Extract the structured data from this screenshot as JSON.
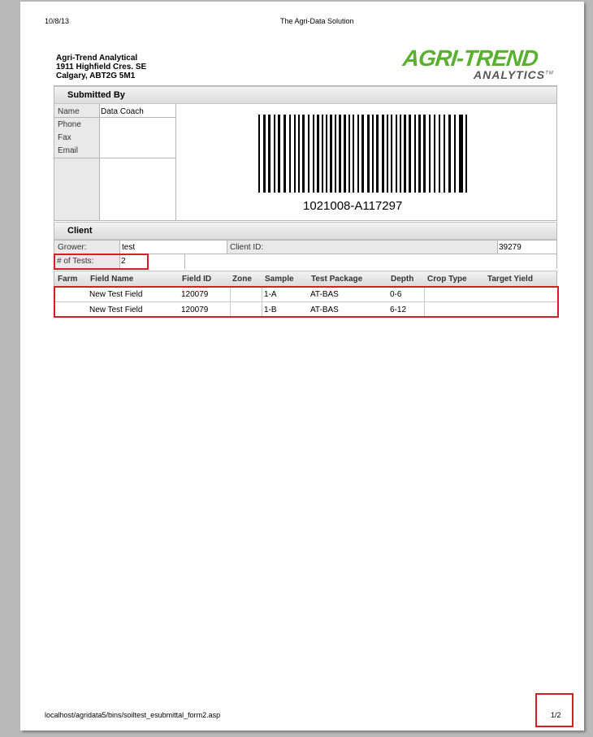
{
  "header": {
    "date": "10/8/13",
    "title": "The Agri-Data Solution"
  },
  "lab": {
    "name": "Agri-Trend Analytical",
    "street": "1911 Highfield Cres. SE",
    "city": "Calgary, ABT2G 5M1"
  },
  "logo": {
    "top": "AGRI-TREND",
    "bottom": "ANALYTICS",
    "tm": "TM"
  },
  "submitted_by": {
    "heading": "Submitted By",
    "name_label": "Name",
    "name_value": "Data Coach",
    "phone_label": "Phone",
    "fax_label": "Fax",
    "email_label": "Email"
  },
  "barcode": {
    "text": "1021008-A117297"
  },
  "client": {
    "heading": "Client",
    "grower_label": "Grower:",
    "grower_value": "test",
    "client_id_label": "Client ID:",
    "client_id_value": "39279",
    "tests_label": "# of Tests:",
    "tests_value": "2"
  },
  "table": {
    "headers": [
      "Farm",
      "Field Name",
      "Field ID",
      "Zone",
      "Sample",
      "Test Package",
      "Depth",
      "Crop Type",
      "Target Yield"
    ],
    "rows": [
      {
        "farm": "",
        "field_name": "New Test Field",
        "field_id": "120079",
        "zone": "",
        "sample": "1-A",
        "package": "AT-BAS",
        "depth": "0-6",
        "crop": "",
        "yield": ""
      },
      {
        "farm": "",
        "field_name": "New Test Field",
        "field_id": "120079",
        "zone": "",
        "sample": "1-B",
        "package": "AT-BAS",
        "depth": "6-12",
        "crop": "",
        "yield": ""
      }
    ]
  },
  "footer": {
    "url": "localhost/agridata5/bins/soiltest_esubmittal_form2.asp",
    "page": "1/2"
  },
  "colors": {
    "brand_green": "#5ab031",
    "highlight_red": "#d41f26"
  }
}
